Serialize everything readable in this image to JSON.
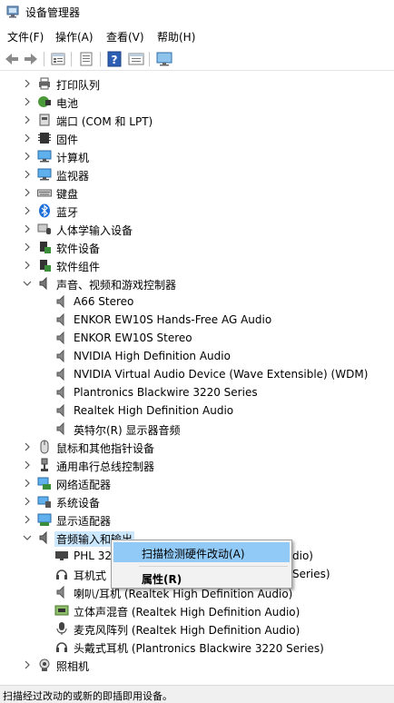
{
  "window": {
    "title": "设备管理器",
    "icon": "device-manager-icon"
  },
  "menu": {
    "file": "文件(F)",
    "action": "操作(A)",
    "view": "查看(V)",
    "help": "帮助(H)"
  },
  "toolbar": [
    "back-arrow-icon",
    "forward-arrow-icon",
    "device-tree-icon",
    "properties-sheet-icon",
    "help-icon",
    "update-driver-icon",
    "monitor-scan-icon"
  ],
  "tree": {
    "printer_queue": "打印队列",
    "battery": "电池",
    "ports": "端口 (COM 和 LPT)",
    "firmware": "固件",
    "computer": "计算机",
    "monitors": "监视器",
    "keyboards": "键盘",
    "bluetooth": "蓝牙",
    "hid": "人体学输入设备",
    "software_devices": "软件设备",
    "software_components": "软件组件",
    "sound": {
      "label": "声音、视频和游戏控制器",
      "children": [
        "A66 Stereo",
        "ENKOR EW10S Hands-Free AG Audio",
        "ENKOR EW10S Stereo",
        "NVIDIA High Definition Audio",
        "NVIDIA Virtual Audio Device (Wave Extensible) (WDM)",
        "Plantronics Blackwire 3220 Series",
        "Realtek High Definition Audio",
        "英特尔(R) 显示器音频"
      ]
    },
    "mice": "鼠标和其他指针设备",
    "usb": "通用串行总线控制器",
    "network": "网络适配器",
    "system": "系统设备",
    "display": "显示适配器",
    "audio_io": {
      "label": "音频输入和输出",
      "children": [
        "PHL 32",
        "耳机式",
        "喇叭/耳机 (Realtek High Definition Audio)",
        "立体声混音 (Realtek High Definition Audio)",
        "麦克风阵列 (Realtek High Definition Audio)",
        "头戴式耳机 (Plantronics Blackwire 3220 Series)"
      ],
      "partial_suffix": {
        "phl": "dio)",
        "headset": "Series)"
      }
    },
    "camera": "照相机"
  },
  "context_menu": {
    "scan": "扫描检测硬件改动(A)",
    "properties": "属性(R)"
  },
  "status": "扫描经过改动的或新的即插即用设备。"
}
